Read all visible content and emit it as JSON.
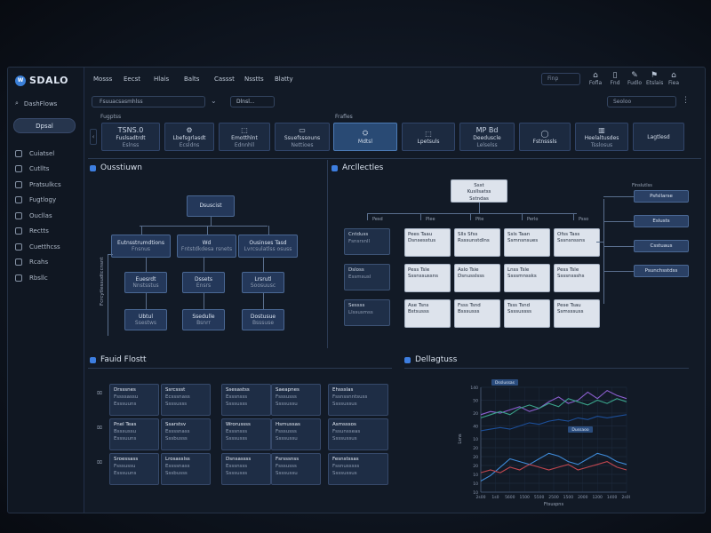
{
  "app": {
    "title": "SDALO",
    "logo_mark": "W"
  },
  "sidebar": {
    "search_label": "DashFlows",
    "primary_button": "Dpsal",
    "items": [
      {
        "label": "Cuiatsel",
        "icon": "document-icon"
      },
      {
        "label": "Cutllts",
        "icon": "chart-icon"
      },
      {
        "label": "Pratsulkcs",
        "icon": "flow-icon"
      },
      {
        "label": "Fugtlogy",
        "icon": "pencil-icon"
      },
      {
        "label": "Oucllas",
        "icon": "bars-icon"
      },
      {
        "label": "Rectts",
        "icon": "tag-icon"
      },
      {
        "label": "Cuetthcss",
        "icon": "map-icon"
      },
      {
        "label": "Rcahs",
        "icon": "flag-icon"
      },
      {
        "label": "Rbsllc",
        "icon": "circle-icon"
      }
    ]
  },
  "topnav": {
    "menu": [
      "Mosss",
      "Eecst",
      "Hlais",
      "Balts",
      "Cassst",
      "Nsstts",
      "Blatty"
    ],
    "search_placeholder": "Finp",
    "icons": [
      {
        "label": "Fofla",
        "glyph": "⌂",
        "name": "home-icon"
      },
      {
        "label": "Fnd",
        "glyph": "▯",
        "name": "phone-icon"
      },
      {
        "label": "Fudlo",
        "glyph": "✎",
        "name": "edit-icon"
      },
      {
        "label": "Etslais",
        "glyph": "⚑",
        "name": "alert-icon"
      },
      {
        "label": "Fiea",
        "glyph": "⌂",
        "name": "building-icon"
      }
    ]
  },
  "toolbar": {
    "input_value": "Fsuuacsasmhlss",
    "select_value": "Dlnsl...",
    "right_input": "Seoloo",
    "more": "⋮"
  },
  "strip_left": {
    "label": "Fugptss",
    "cards": [
      {
        "title": "TSNS.0",
        "sub": "Fuslsadtrdt",
        "sub2": "Eslnss",
        "icon": ""
      },
      {
        "title": "",
        "sub": "Lbefsgrlasdt",
        "sub2": "Ecsldns",
        "icon": "⚙"
      },
      {
        "title": "",
        "sub": "Emotthlnt",
        "sub2": "Ednnhll",
        "icon": "⬚"
      },
      {
        "title": "",
        "sub": "Ssuefsssouns",
        "sub2": "Nettioes",
        "icon": "▭"
      }
    ]
  },
  "strip_right": {
    "label": "Frafles",
    "cards": [
      {
        "title": "",
        "sub": "Mdtsl",
        "sub2": "",
        "icon": "⛭"
      },
      {
        "title": "",
        "sub": "Lpetsuls",
        "sub2": "",
        "icon": "⬚"
      },
      {
        "title": "MP Bd",
        "sub": "Deeduscle",
        "sub2": "Lelselss",
        "icon": ""
      },
      {
        "title": "",
        "sub": "Fstnsssls",
        "sub2": "",
        "icon": "◯"
      },
      {
        "title": "",
        "sub": "Heelaltusdes",
        "sub2": "Tsslosus",
        "icon": "▥"
      },
      {
        "title": "",
        "sub": "Lagtlesd",
        "sub2": "",
        "icon": ""
      }
    ]
  },
  "overview": {
    "title": "Ousstiuwn",
    "side_label": "Fcrcytlessudtccnsnt",
    "root": "Dsuscist",
    "mid": [
      {
        "a": "Eutnsstrumdtions",
        "b": "Fnsnus"
      },
      {
        "a": "Wd",
        "b": "Fntstdkdesa rsnets"
      },
      {
        "a": "Ousinses Tasd",
        "b": "Lvrcsulatlss osuss"
      }
    ],
    "low": [
      {
        "a": "Euesrdt",
        "b": "Nnstsstus"
      },
      {
        "a": "Dssets",
        "b": "Ensrs"
      },
      {
        "a": "Lrsrutl",
        "b": "Soosuusc"
      }
    ],
    "leaf": [
      {
        "a": "Ubtul",
        "b": "Ssestws"
      },
      {
        "a": "Ssedulle",
        "b": "Bsnrr"
      },
      {
        "a": "Dostusue",
        "b": "Bsssuse"
      }
    ]
  },
  "architecture": {
    "title": "Arcllectles",
    "root_a": "Ssst",
    "root_b": "Kusllsatss",
    "root_c": "Sstndas",
    "col_labels": [
      "Pesd",
      "Plee",
      "Pite",
      "Perlo",
      "Psso"
    ],
    "left_boxes": [
      {
        "a": "Cntduss",
        "b": "Fsnsrsnll"
      },
      {
        "a": "Dsloss",
        "b": "Essmsusl"
      },
      {
        "a": "Sessss",
        "b": "Llssusmss"
      }
    ],
    "grid": [
      [
        {
          "a": "Pees Taau",
          "b": "Dsnsesstus"
        },
        {
          "a": "Slls Sfss",
          "b": "Rsssunstdlns"
        },
        {
          "a": "Ssls Taan",
          "b": "Ssmnsnsues"
        },
        {
          "a": "Ofss Tass",
          "b": "Sssnsnssns"
        }
      ],
      [
        {
          "a": "Pess Tsle",
          "b": "Sssnssussns"
        },
        {
          "a": "Aslo Tsie",
          "b": "Dsnusslsss"
        },
        {
          "a": "Lnss Tsle",
          "b": "Ssssmnssks"
        },
        {
          "a": "Pess Tsle",
          "b": "Ssssnssshs"
        }
      ],
      [
        {
          "a": "Ase Tsns",
          "b": "Bstsusss"
        },
        {
          "a": "Fsss Tsnd",
          "b": "Bsssusss"
        },
        {
          "a": "Tsss Tsnd",
          "b": "Ssssussss"
        },
        {
          "a": "Pese Tsau",
          "b": "Ssmsssuss"
        }
      ]
    ],
    "right_label": "Finslutlss",
    "right_boxes": [
      "Psfsllarse",
      "Eslusts",
      "Csstuaus",
      "Psunchsstdss"
    ]
  },
  "field_fonts": {
    "title": "Fauid Flostt",
    "row_markers": [
      "⌧",
      "⌧",
      "⌧"
    ],
    "cards": [
      [
        {
          "a": "Drsssnes",
          "b": "Fssssassu",
          "c": "Esssuuns"
        },
        {
          "a": "Ssrcssst",
          "b": "Ecsssnass",
          "c": "Ssssusss"
        },
        {
          "a": "Ssesastss",
          "b": "Esssnsss",
          "c": "Ssssusss"
        },
        {
          "a": "Saeapnes",
          "b": "Fsssusss",
          "c": "Ssssussu"
        }
      ],
      [
        {
          "a": "Pnel Teas",
          "b": "Bsssussu",
          "c": "Esssuuns"
        },
        {
          "a": "Ssarstsv",
          "b": "Essssnass",
          "c": "Sssbusss"
        },
        {
          "a": "Wrorussss",
          "b": "Esssnsss",
          "c": "Ssssusss"
        },
        {
          "a": "Hsmussas",
          "b": "Fsssusss",
          "c": "Ssssussu"
        }
      ],
      [
        {
          "a": "Sroessass",
          "b": "Fsssussu",
          "c": "Esssuuns"
        },
        {
          "a": "Lrosasslss",
          "b": "Essssnass",
          "c": "Sssbusss"
        },
        {
          "a": "Dsnsassss",
          "b": "Esssnsss",
          "c": "Ssssusss"
        },
        {
          "a": "Fsrsssnss",
          "b": "Fsssusss",
          "c": "Ssssussu"
        }
      ]
    ],
    "side_cards": [
      {
        "a": "Ehssslas",
        "b": "Fssnssnntsuss",
        "c": "Ssssussus"
      },
      {
        "a": "Asmsssos",
        "b": "Fssunsseas",
        "c": "Ssssussus"
      },
      {
        "a": "Fesnstssas",
        "b": "Fssnusssss",
        "c": "Ssssussus"
      }
    ]
  },
  "analytics": {
    "title": "Dellagtuss",
    "legend_a": "Dsslussas",
    "legend_b": "Dussaoo",
    "xlabel": "Ftsuspns",
    "ylabel": "Lsns",
    "x_ticks": [
      "2s00",
      "1s0",
      "5600",
      "1500",
      "5500",
      "2500",
      "1500",
      "2000",
      "1200",
      "1400",
      "2s00"
    ],
    "y_ticks_top": [
      "140",
      "50",
      "20",
      "40",
      "10"
    ],
    "y_ticks_bottom": [
      "20",
      "20",
      "20",
      "10",
      "10",
      "10"
    ],
    "colors": {
      "blue": "#3e8ad8",
      "red": "#c0464f",
      "purple": "#8c5fd0",
      "green": "#3aa38a",
      "navy": "#1c4f9a"
    },
    "chart_data": {
      "type": "line",
      "series_top": [
        {
          "color": "purple",
          "values": [
            30,
            34,
            32,
            36,
            40,
            34,
            38,
            46,
            52,
            44,
            48,
            58,
            50,
            60,
            54,
            50
          ]
        },
        {
          "color": "green",
          "values": [
            26,
            30,
            34,
            30,
            38,
            42,
            38,
            44,
            40,
            50,
            46,
            42,
            48,
            44,
            50,
            46
          ]
        },
        {
          "color": "navy",
          "values": [
            10,
            12,
            14,
            12,
            16,
            20,
            18,
            22,
            24,
            22,
            26,
            24,
            28,
            26,
            28,
            30
          ]
        }
      ],
      "series_bottom": [
        {
          "color": "blue",
          "values": [
            8,
            12,
            18,
            24,
            22,
            20,
            24,
            28,
            26,
            22,
            20,
            24,
            28,
            26,
            22,
            20
          ]
        },
        {
          "color": "red",
          "values": [
            14,
            16,
            14,
            18,
            16,
            20,
            18,
            16,
            18,
            20,
            16,
            18,
            20,
            22,
            18,
            16
          ]
        }
      ]
    }
  }
}
